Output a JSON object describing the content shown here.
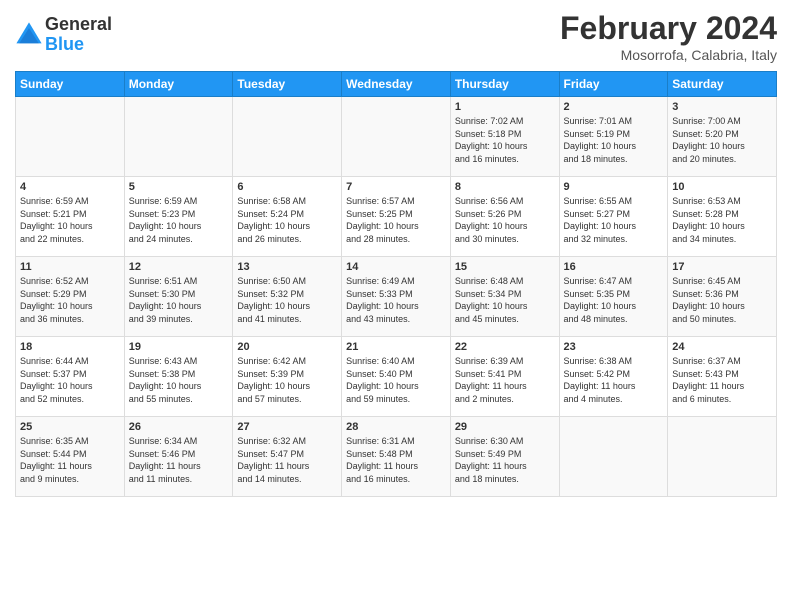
{
  "header": {
    "logo_line1": "General",
    "logo_line2": "Blue",
    "title": "February 2024",
    "subtitle": "Mosorrofa, Calabria, Italy"
  },
  "weekdays": [
    "Sunday",
    "Monday",
    "Tuesday",
    "Wednesday",
    "Thursday",
    "Friday",
    "Saturday"
  ],
  "weeks": [
    [
      {
        "day": "",
        "info": ""
      },
      {
        "day": "",
        "info": ""
      },
      {
        "day": "",
        "info": ""
      },
      {
        "day": "",
        "info": ""
      },
      {
        "day": "1",
        "info": "Sunrise: 7:02 AM\nSunset: 5:18 PM\nDaylight: 10 hours\nand 16 minutes."
      },
      {
        "day": "2",
        "info": "Sunrise: 7:01 AM\nSunset: 5:19 PM\nDaylight: 10 hours\nand 18 minutes."
      },
      {
        "day": "3",
        "info": "Sunrise: 7:00 AM\nSunset: 5:20 PM\nDaylight: 10 hours\nand 20 minutes."
      }
    ],
    [
      {
        "day": "4",
        "info": "Sunrise: 6:59 AM\nSunset: 5:21 PM\nDaylight: 10 hours\nand 22 minutes."
      },
      {
        "day": "5",
        "info": "Sunrise: 6:59 AM\nSunset: 5:23 PM\nDaylight: 10 hours\nand 24 minutes."
      },
      {
        "day": "6",
        "info": "Sunrise: 6:58 AM\nSunset: 5:24 PM\nDaylight: 10 hours\nand 26 minutes."
      },
      {
        "day": "7",
        "info": "Sunrise: 6:57 AM\nSunset: 5:25 PM\nDaylight: 10 hours\nand 28 minutes."
      },
      {
        "day": "8",
        "info": "Sunrise: 6:56 AM\nSunset: 5:26 PM\nDaylight: 10 hours\nand 30 minutes."
      },
      {
        "day": "9",
        "info": "Sunrise: 6:55 AM\nSunset: 5:27 PM\nDaylight: 10 hours\nand 32 minutes."
      },
      {
        "day": "10",
        "info": "Sunrise: 6:53 AM\nSunset: 5:28 PM\nDaylight: 10 hours\nand 34 minutes."
      }
    ],
    [
      {
        "day": "11",
        "info": "Sunrise: 6:52 AM\nSunset: 5:29 PM\nDaylight: 10 hours\nand 36 minutes."
      },
      {
        "day": "12",
        "info": "Sunrise: 6:51 AM\nSunset: 5:30 PM\nDaylight: 10 hours\nand 39 minutes."
      },
      {
        "day": "13",
        "info": "Sunrise: 6:50 AM\nSunset: 5:32 PM\nDaylight: 10 hours\nand 41 minutes."
      },
      {
        "day": "14",
        "info": "Sunrise: 6:49 AM\nSunset: 5:33 PM\nDaylight: 10 hours\nand 43 minutes."
      },
      {
        "day": "15",
        "info": "Sunrise: 6:48 AM\nSunset: 5:34 PM\nDaylight: 10 hours\nand 45 minutes."
      },
      {
        "day": "16",
        "info": "Sunrise: 6:47 AM\nSunset: 5:35 PM\nDaylight: 10 hours\nand 48 minutes."
      },
      {
        "day": "17",
        "info": "Sunrise: 6:45 AM\nSunset: 5:36 PM\nDaylight: 10 hours\nand 50 minutes."
      }
    ],
    [
      {
        "day": "18",
        "info": "Sunrise: 6:44 AM\nSunset: 5:37 PM\nDaylight: 10 hours\nand 52 minutes."
      },
      {
        "day": "19",
        "info": "Sunrise: 6:43 AM\nSunset: 5:38 PM\nDaylight: 10 hours\nand 55 minutes."
      },
      {
        "day": "20",
        "info": "Sunrise: 6:42 AM\nSunset: 5:39 PM\nDaylight: 10 hours\nand 57 minutes."
      },
      {
        "day": "21",
        "info": "Sunrise: 6:40 AM\nSunset: 5:40 PM\nDaylight: 10 hours\nand 59 minutes."
      },
      {
        "day": "22",
        "info": "Sunrise: 6:39 AM\nSunset: 5:41 PM\nDaylight: 11 hours\nand 2 minutes."
      },
      {
        "day": "23",
        "info": "Sunrise: 6:38 AM\nSunset: 5:42 PM\nDaylight: 11 hours\nand 4 minutes."
      },
      {
        "day": "24",
        "info": "Sunrise: 6:37 AM\nSunset: 5:43 PM\nDaylight: 11 hours\nand 6 minutes."
      }
    ],
    [
      {
        "day": "25",
        "info": "Sunrise: 6:35 AM\nSunset: 5:44 PM\nDaylight: 11 hours\nand 9 minutes."
      },
      {
        "day": "26",
        "info": "Sunrise: 6:34 AM\nSunset: 5:46 PM\nDaylight: 11 hours\nand 11 minutes."
      },
      {
        "day": "27",
        "info": "Sunrise: 6:32 AM\nSunset: 5:47 PM\nDaylight: 11 hours\nand 14 minutes."
      },
      {
        "day": "28",
        "info": "Sunrise: 6:31 AM\nSunset: 5:48 PM\nDaylight: 11 hours\nand 16 minutes."
      },
      {
        "day": "29",
        "info": "Sunrise: 6:30 AM\nSunset: 5:49 PM\nDaylight: 11 hours\nand 18 minutes."
      },
      {
        "day": "",
        "info": ""
      },
      {
        "day": "",
        "info": ""
      }
    ]
  ]
}
